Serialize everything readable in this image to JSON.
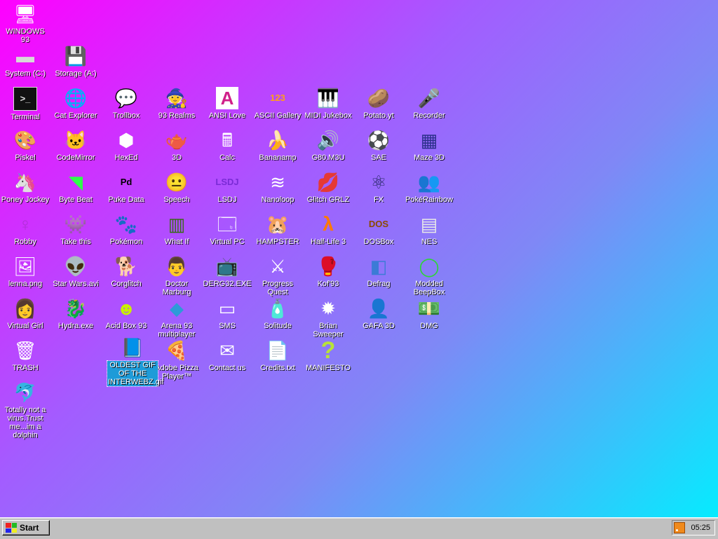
{
  "desktop_icons": [
    {
      "label": "WINDOWS 93",
      "icon": "computer-icon",
      "name": "icon-windows-93"
    },
    {
      "label": "System (C:)",
      "icon": "drive-icon",
      "name": "icon-system-c"
    },
    {
      "label": "Storage (A:)",
      "icon": "floppy-drive-icon",
      "name": "icon-storage-a"
    },
    {
      "label": "Terminal",
      "icon": "terminal-icon",
      "name": "icon-terminal"
    },
    {
      "label": "Cat Explorer",
      "icon": "cat-globe-icon",
      "name": "icon-cat-explorer"
    },
    {
      "label": "Trollbox",
      "icon": "chat-smiley-icon",
      "name": "icon-trollbox"
    },
    {
      "label": "93 Realms",
      "icon": "mage-icon",
      "name": "icon-93-realms"
    },
    {
      "label": "ANSI Love",
      "icon": "letter-a-icon",
      "name": "icon-ansi-love"
    },
    {
      "label": "ASCII Gallery",
      "icon": "digits-123-icon",
      "name": "icon-ascii-gallery"
    },
    {
      "label": "MIDI Jukebox",
      "icon": "piano-keys-icon",
      "name": "icon-midi-jukebox"
    },
    {
      "label": "Potato.yt",
      "icon": "potato-icon",
      "name": "icon-potato-yt"
    },
    {
      "label": "Recorder",
      "icon": "microphone-icon",
      "name": "icon-recorder"
    },
    {
      "label": "Piskel",
      "icon": "palette-icon",
      "name": "icon-piskel"
    },
    {
      "label": "CodeMirror",
      "icon": "cat-code-icon",
      "name": "icon-codemirror"
    },
    {
      "label": "HexEd",
      "icon": "cube-icon",
      "name": "icon-hexed"
    },
    {
      "label": "3D",
      "icon": "teapot-icon",
      "name": "icon-3d"
    },
    {
      "label": "Calc",
      "icon": "calculator-icon",
      "name": "icon-calc"
    },
    {
      "label": "Bananamp",
      "icon": "banana-icon",
      "name": "icon-bananamp"
    },
    {
      "label": "G80.M3U",
      "icon": "speaker-file-icon",
      "name": "icon-g80-m3u"
    },
    {
      "label": "SAE",
      "icon": "checkered-ball-icon",
      "name": "icon-sae"
    },
    {
      "label": "Maze 3D",
      "icon": "maze-icon",
      "name": "icon-maze-3d"
    },
    {
      "label": "Poney Jockey",
      "icon": "pony-icon",
      "name": "icon-poney-jockey"
    },
    {
      "label": "Byte Beat",
      "icon": "wave-icon",
      "name": "icon-byte-beat"
    },
    {
      "label": "Puke Data",
      "icon": "pd-icon",
      "name": "icon-puke-data"
    },
    {
      "label": "Speech",
      "icon": "face-icon",
      "name": "icon-speech"
    },
    {
      "label": "LSDJ",
      "icon": "gameboy-icon",
      "name": "icon-lsdj"
    },
    {
      "label": "Nanoloop",
      "icon": "waveform-icon",
      "name": "icon-nanoloop"
    },
    {
      "label": "Glitch GRLZ",
      "icon": "lips-icon",
      "name": "icon-glitch-grlz"
    },
    {
      "label": "FX",
      "icon": "atom-icon",
      "name": "icon-fx"
    },
    {
      "label": "PokéRainbow",
      "icon": "trainers-icon",
      "name": "icon-pokerainbow"
    },
    {
      "label": "Robby",
      "icon": "stick-figure-icon",
      "name": "icon-robby"
    },
    {
      "label": "Take this",
      "icon": "pixel-character-icon",
      "name": "icon-take-this"
    },
    {
      "label": "Pokémon",
      "icon": "monster-icon",
      "name": "icon-pokemon"
    },
    {
      "label": "What If",
      "icon": "barcode-icon",
      "name": "icon-what-if"
    },
    {
      "label": "Virtual PC",
      "icon": "window-icon",
      "name": "icon-virtual-pc"
    },
    {
      "label": "HAMPSTER",
      "icon": "hamster-icon",
      "name": "icon-hampster"
    },
    {
      "label": "Half-Life 3",
      "icon": "lambda-icon",
      "name": "icon-half-life-3"
    },
    {
      "label": "DOSBox",
      "icon": "dosbox-icon",
      "name": "icon-dosbox"
    },
    {
      "label": "NES",
      "icon": "console-icon",
      "name": "icon-nes"
    },
    {
      "label": "lenna.png",
      "icon": "image-file-icon",
      "name": "icon-lenna-png"
    },
    {
      "label": "Star Wars.avi",
      "icon": "yoda-icon",
      "name": "icon-star-wars-avi"
    },
    {
      "label": "Corglitch",
      "icon": "corgi-icon",
      "name": "icon-corglitch"
    },
    {
      "label": "Doctor Marburg",
      "icon": "doctor-icon",
      "name": "icon-doctor-marburg"
    },
    {
      "label": "DERG32.EXE",
      "icon": "monitor-face-icon",
      "name": "icon-derg32-exe"
    },
    {
      "label": "Progress Quest",
      "icon": "crossed-swords-icon",
      "name": "icon-progress-quest"
    },
    {
      "label": "Kof'93",
      "icon": "fighter-icon",
      "name": "icon-kof93"
    },
    {
      "label": "Defrag",
      "icon": "defrag-icon",
      "name": "icon-defrag"
    },
    {
      "label": "Modded BeepBox",
      "icon": "green-ring-icon",
      "name": "icon-modded-beepbox"
    },
    {
      "label": "Virtual Girl",
      "icon": "girl-icon",
      "name": "icon-virtual-girl"
    },
    {
      "label": "Hydra.exe",
      "icon": "dragon-icon",
      "name": "icon-hydra-exe"
    },
    {
      "label": "Acid Box 93",
      "icon": "acid-smiley-icon",
      "name": "icon-acid-box-93"
    },
    {
      "label": "Arena 93 multiplayer",
      "icon": "colored-cube-icon",
      "name": "icon-arena-93"
    },
    {
      "label": "SMS",
      "icon": "sms-console-icon",
      "name": "icon-sms"
    },
    {
      "label": "Solitude",
      "icon": "bottle-icon",
      "name": "icon-solitude"
    },
    {
      "label": "Brian Sweeper",
      "icon": "mine-icon",
      "name": "icon-brian-sweeper"
    },
    {
      "label": "GAFA 3D",
      "icon": "doomguy-icon",
      "name": "icon-gafa-3d"
    },
    {
      "label": "DMG",
      "icon": "cash-icon",
      "name": "icon-dmg"
    },
    {
      "label": "TRASH",
      "icon": "recycle-bin-icon",
      "name": "icon-trash"
    },
    {
      "label": "Adobe Pizza Player™",
      "icon": "pizza-icon",
      "name": "icon-adobe-pizza-player"
    },
    {
      "label": "Contact us",
      "icon": "mail-edit-icon",
      "name": "icon-contact-us"
    },
    {
      "label": "Credits.txt",
      "icon": "text-file-icon",
      "name": "icon-credits-txt"
    },
    {
      "label": "MANIFESTO",
      "icon": "question-mark-icon",
      "name": "icon-manifesto"
    },
    {
      "label": "OLDEST GIF OF THE INTERWEBZ.gif",
      "icon": "book-file-icon",
      "name": "icon-oldest-gif",
      "selected": true
    },
    {
      "label": "Totally not a virus.Trust me...im a dolphin",
      "icon": "dolphin-icon",
      "name": "icon-dolphin"
    }
  ],
  "taskbar": {
    "start_label": "Start",
    "clock": "05:25"
  }
}
